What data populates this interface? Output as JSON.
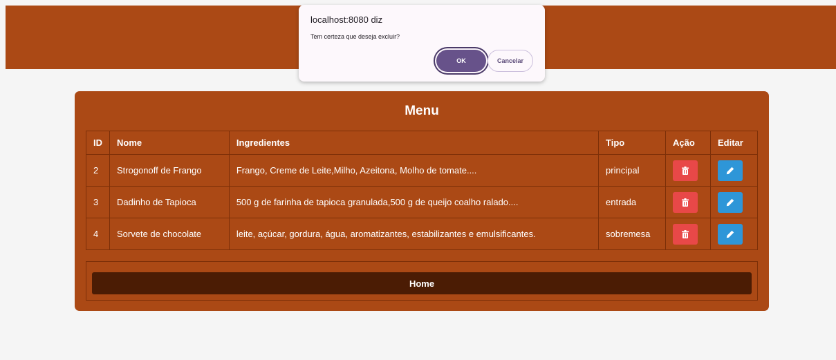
{
  "menu": {
    "title": "Menu",
    "columns": [
      "ID",
      "Nome",
      "Ingredientes",
      "Tipo",
      "Ação",
      "Editar"
    ],
    "rows": [
      {
        "id": "2",
        "nome": "Strogonoff de Frango",
        "ingredientes": "Frango, Creme de Leite,Milho, Azeitona, Molho de tomate....",
        "tipo": "principal"
      },
      {
        "id": "3",
        "nome": "Dadinho de Tapioca",
        "ingredientes": "500 g de farinha de tapioca granulada,500 g de queijo coalho ralado....",
        "tipo": "entrada"
      },
      {
        "id": "4",
        "nome": "Sorvete de chocolate",
        "ingredientes": "leite, açúcar, gordura, água, aromatizantes, estabilizantes e emulsificantes.",
        "tipo": "sobremesa"
      }
    ],
    "home_label": "Home"
  },
  "dialog": {
    "title": "localhost:8080 diz",
    "message": "Tem certeza que deseja excluir?",
    "ok_label": "OK",
    "cancel_label": "Cancelar"
  },
  "icons": {
    "delete": "trash-icon",
    "edit": "pencil-icon"
  },
  "colors": {
    "brand": "#ab4915",
    "home_button": "#4b1c04",
    "delete": "#e84848",
    "edit": "#2e96d8",
    "dialog_accent": "#67528a"
  }
}
